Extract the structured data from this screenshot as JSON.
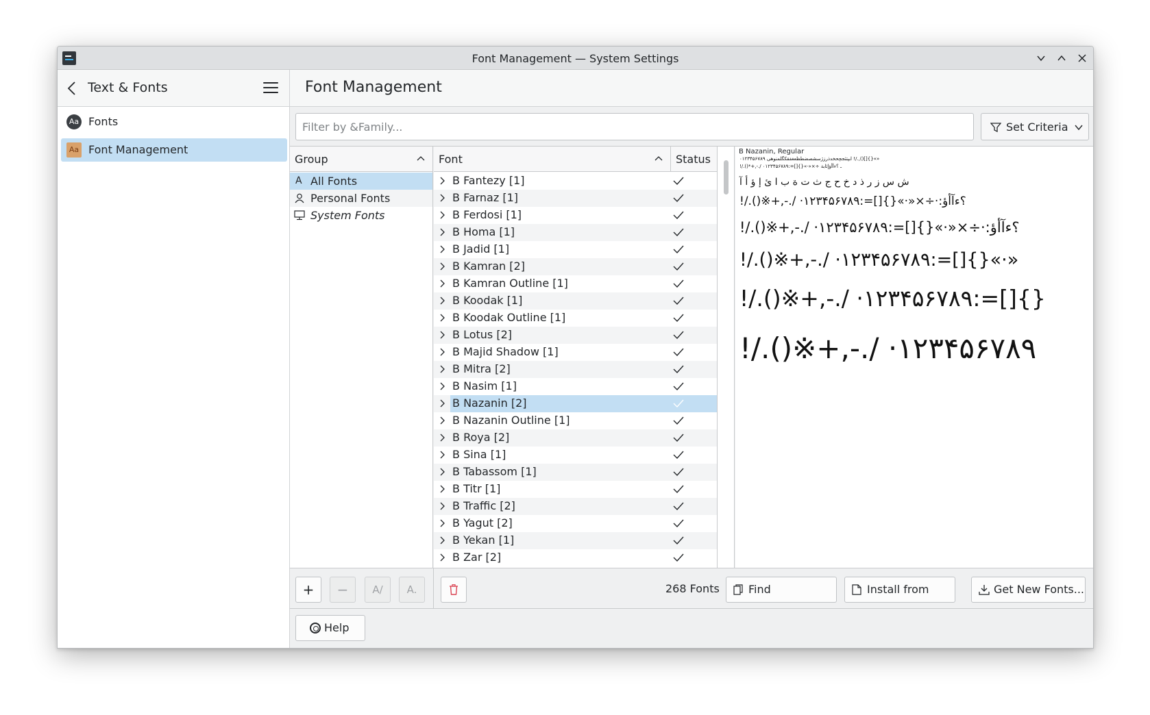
{
  "window": {
    "title": "Font Management — System Settings"
  },
  "sidebar": {
    "header_title": "Text & Fonts",
    "items": [
      {
        "label": "Fonts",
        "icon": "fonts-icon",
        "selected": false
      },
      {
        "label": "Font Management",
        "icon": "font-management-icon",
        "selected": true
      }
    ]
  },
  "main": {
    "title": "Font Management",
    "filter_placeholder": "Filter by &Family...",
    "criteria_label": "Set Criteria",
    "group_header": "Group",
    "font_header": "Font",
    "status_header": "Status",
    "groups": [
      {
        "label": "All Fonts",
        "icon": "font-letter-icon",
        "selected": true
      },
      {
        "label": "Personal Fonts",
        "icon": "user-icon",
        "selected": false
      },
      {
        "label": "System Fonts",
        "icon": "monitor-icon",
        "selected": false
      }
    ],
    "fonts": [
      {
        "name": "B Fantezy [1]",
        "enabled": true
      },
      {
        "name": "B Farnaz [1]",
        "enabled": true
      },
      {
        "name": "B Ferdosi [1]",
        "enabled": true
      },
      {
        "name": "B Homa [1]",
        "enabled": true
      },
      {
        "name": "B Jadid [1]",
        "enabled": true
      },
      {
        "name": "B Kamran [2]",
        "enabled": true
      },
      {
        "name": "B Kamran Outline [1]",
        "enabled": true
      },
      {
        "name": "B Koodak [1]",
        "enabled": true
      },
      {
        "name": "B Koodak Outline [1]",
        "enabled": true
      },
      {
        "name": "B Lotus [2]",
        "enabled": true
      },
      {
        "name": "B Majid Shadow [1]",
        "enabled": true
      },
      {
        "name": "B Mitra [2]",
        "enabled": true
      },
      {
        "name": "B Nasim [1]",
        "enabled": true
      },
      {
        "name": "B Nazanin [2]",
        "enabled": true,
        "selected": true
      },
      {
        "name": "B Nazanin Outline [1]",
        "enabled": true
      },
      {
        "name": "B Roya [2]",
        "enabled": true
      },
      {
        "name": "B Sina [1]",
        "enabled": true
      },
      {
        "name": "B Tabassom [1]",
        "enabled": true
      },
      {
        "name": "B Titr [1]",
        "enabled": true
      },
      {
        "name": "B Traffic [2]",
        "enabled": true
      },
      {
        "name": "B Yagut [2]",
        "enabled": true
      },
      {
        "name": "B Yekan [1]",
        "enabled": true
      },
      {
        "name": "B Zar [2]",
        "enabled": true
      }
    ],
    "preview": {
      "label": "B Nazanin, Regular",
      "lines": [
        "ابپتثجچحخدذرزژسشصضطظعغفقکگلمنوهی ۰۱۲۳۴۵۶۷۸۹ !/.,()[]{}«»",
        "!/.()*+,-./ ۰۱۲۳۴۵۶۷۸۹:=[]{}«·»×÷ ـ ؟ءآأؤإئابة",
        "ش س ز ر ذ د خ ح ج ث ت ة ب ا ئ إ ؤ أ آ",
        "!/.()※+,-./ ·۱۲۳۴۵۶۷۸۹:=[]{}«·»×÷·:؟ءآأؤ",
        "!/.()※+,-./ ·۱۲۳۴۵۶۷۸۹:=[]{}«·»×÷·:؟ءآأؤ",
        "!/.()※+,-./ ·۱۲۳۴۵۶۷۸۹:=[]{}«·»",
        "!/.()※+,-./ ·۱۲۳۴۵۶۷۸۹:=[]{}",
        "!/.()※+,-./ ·۱۲۳۴۵۶۷۸۹"
      ]
    },
    "font_count": "268 Fonts",
    "buttons": {
      "find_duplicates": "Find Duplicates...",
      "install_from_file": "Install from File...",
      "get_new_fonts": "Get New Fonts..."
    },
    "help_label": "Help"
  },
  "colors": {
    "selection": "#c2def3",
    "window_bg": "#eff0f1",
    "delete_icon": "#da4453"
  }
}
